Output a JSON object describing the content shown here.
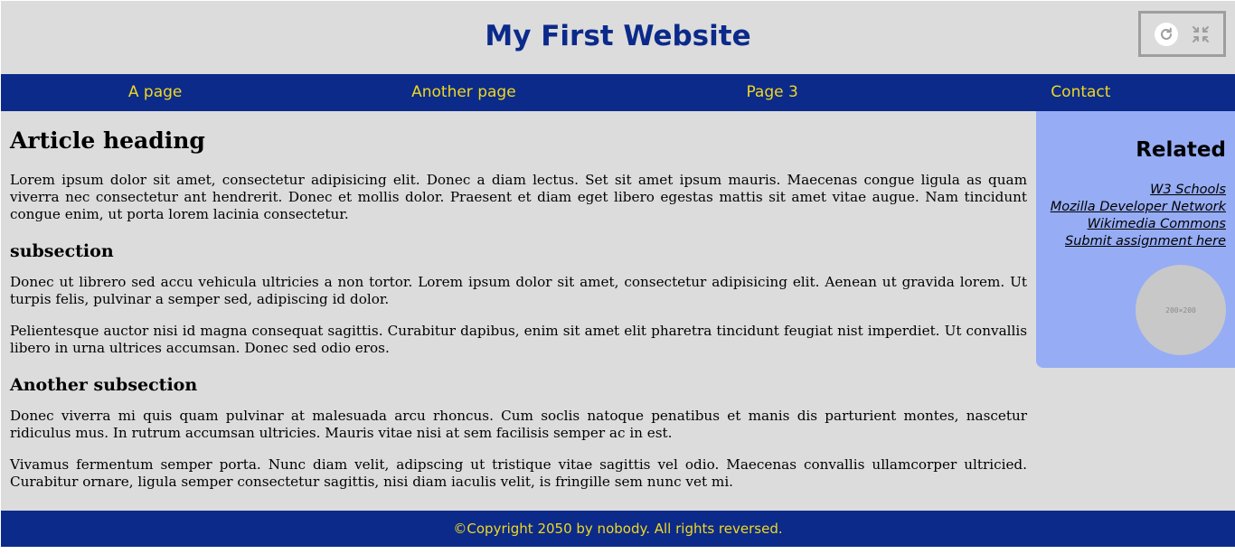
{
  "header": {
    "title": "My First Website",
    "controls": {
      "reload_icon": "reload-icon",
      "collapse_icon": "collapse-icon"
    }
  },
  "nav": {
    "items": [
      {
        "label": "A page"
      },
      {
        "label": "Another page"
      },
      {
        "label": "Page 3"
      },
      {
        "label": "Contact"
      }
    ]
  },
  "article": {
    "heading": "Article heading",
    "paragraph_1": "Lorem ipsum dolor sit amet, consectetur adipisicing elit. Donec a diam lectus. Set sit amet ipsum mauris. Maecenas congue ligula as quam viverra nec consectetur ant hendrerit. Donec et mollis dolor. Praesent et diam eget libero egestas mattis sit amet vitae augue. Nam tincidunt congue enim, ut porta lorem lacinia consectetur.",
    "subsection_heading": "subsection",
    "paragraph_2": "Donec ut librero sed accu vehicula ultricies a non tortor. Lorem ipsum dolor sit amet, consectetur adipisicing elit. Aenean ut gravida lorem. Ut turpis felis, pulvinar a semper sed, adipiscing id dolor.",
    "paragraph_3": "Pelientesque auctor nisi id magna consequat sagittis. Curabitur dapibus, enim sit amet elit pharetra tincidunt feugiat nist imperdiet. Ut convallis libero in urna ultrices accumsan. Donec sed odio eros.",
    "another_subsection_heading": "Another subsection",
    "paragraph_4": "Donec viverra mi quis quam pulvinar at malesuada arcu rhoncus. Cum soclis natoque penatibus et manis dis parturient montes, nascetur ridiculus mus. In rutrum accumsan ultricies. Mauris vitae nisi at sem facilisis semper ac in est.",
    "paragraph_5": "Vivamus fermentum semper porta. Nunc diam velit, adipscing ut tristique vitae sagittis vel odio. Maecenas convallis ullamcorper ultricied. Curabitur ornare, ligula semper consectetur sagittis, nisi diam iaculis velit, is fringille sem nunc vet mi."
  },
  "aside": {
    "title": "Related",
    "links": [
      {
        "label": "W3 Schools"
      },
      {
        "label": "Mozilla Developer Network"
      },
      {
        "label": "Wikimedia Commons"
      },
      {
        "label": "Submit assignment here"
      }
    ],
    "image_label": "200×200"
  },
  "footer": {
    "text": "©Copyright 2050 by nobody. All rights reversed."
  },
  "colors": {
    "background": "#dcdcdc",
    "brand_blue": "#0b2a8a",
    "nav_text_yellow": "#f0d820",
    "aside_background": "#96acf4"
  }
}
